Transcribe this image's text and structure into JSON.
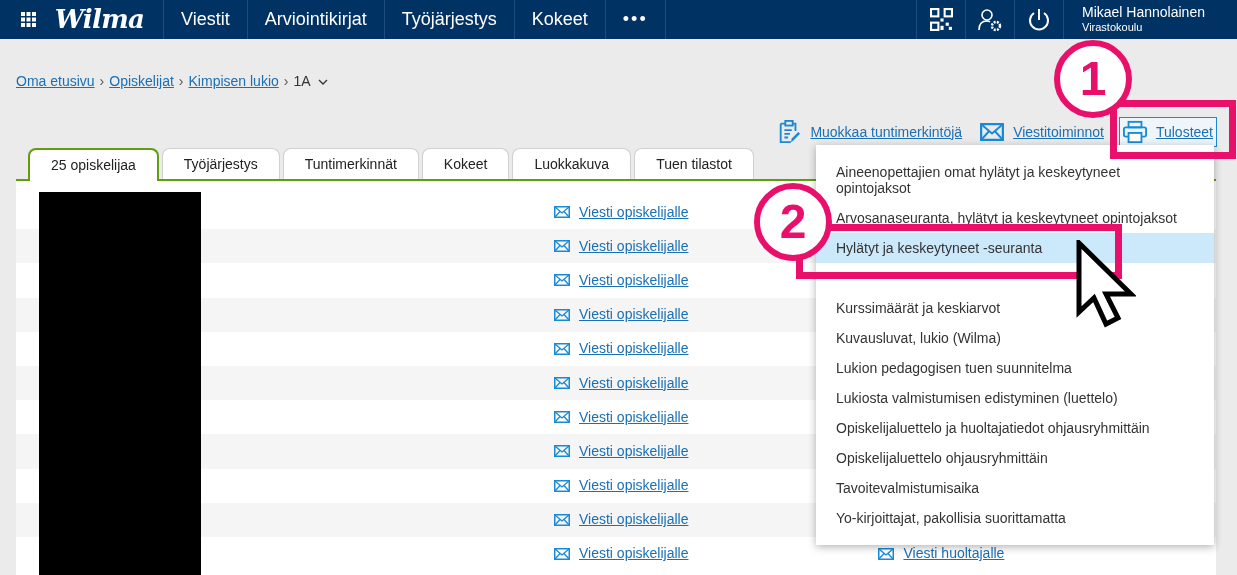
{
  "navbar": {
    "logo": "Wilma",
    "items": [
      "Viestit",
      "Arviointikirjat",
      "Työjärjestys",
      "Kokeet",
      "•••"
    ],
    "user": {
      "name": "Mikael Hannolainen",
      "school": "Virastokoulu"
    }
  },
  "breadcrumb": {
    "links": [
      "Oma etusivu",
      "Opiskelijat",
      "Kimpisen lukio"
    ],
    "separator": "›",
    "current": "1A"
  },
  "actions": [
    {
      "kind": "edit",
      "label": "Muokkaa tuntimerkintöjä",
      "selected": false
    },
    {
      "kind": "mail",
      "label": "Viestitoiminnot",
      "selected": false
    },
    {
      "kind": "print",
      "label": "Tulosteet",
      "selected": true
    }
  ],
  "tabs": [
    {
      "label": "25 opiskelijaa",
      "selected": true
    },
    {
      "label": "Työjärjestys",
      "selected": false
    },
    {
      "label": "Tuntimerkinnät",
      "selected": false
    },
    {
      "label": "Kokeet",
      "selected": false
    },
    {
      "label": "Luokkakuva",
      "selected": false
    },
    {
      "label": "Tuen tilastot",
      "selected": false
    }
  ],
  "rows": [
    {
      "student_link": "Viesti opiskelijalle"
    },
    {
      "student_link": "Viesti opiskelijalle"
    },
    {
      "student_link": "Viesti opiskelijalle"
    },
    {
      "student_link": "Viesti opiskelijalle"
    },
    {
      "student_link": "Viesti opiskelijalle"
    },
    {
      "student_link": "Viesti opiskelijalle"
    },
    {
      "student_link": "Viesti opiskelijalle"
    },
    {
      "student_link": "Viesti opiskelijalle"
    },
    {
      "student_link": "Viesti opiskelijalle"
    },
    {
      "student_link": "Viesti opiskelijalle"
    },
    {
      "student_link": "Viesti opiskelijalle",
      "guardian_link": "Viesti huoltajalle"
    }
  ],
  "menu": {
    "items": [
      {
        "label": "Aineenopettajien omat hylätyt ja keskeytyneet opintojaksot",
        "selected": false
      },
      {
        "label": "Arvosanaseuranta, hylätyt ja keskeytyneet opintojaksot",
        "selected": false
      },
      {
        "label": "Hylätyt ja keskeytyneet -seuranta",
        "selected": true
      },
      {
        "selected": false
      },
      {
        "label": "Kurssimäärät ja keskiarvot",
        "selected": false
      },
      {
        "label": "Kuvausluvat, lukio (Wilma)",
        "selected": false
      },
      {
        "label": "Lukion pedagogisen tuen suunnitelma",
        "selected": false
      },
      {
        "label": "Lukiosta valmistumisen edistyminen (luettelo)",
        "selected": false
      },
      {
        "label": "Opiskelijaluettelo ja huoltajatiedot ohjausryhmittäin",
        "selected": false
      },
      {
        "label": "Opiskelijaluettelo ohjausryhmittäin",
        "selected": false
      },
      {
        "label": "Tavoitevalmistumisaika",
        "selected": false
      },
      {
        "label": "Yo-kirjoittajat, pakollisia suorittamatta",
        "selected": false
      }
    ]
  },
  "annotations": [
    "1",
    "2"
  ]
}
